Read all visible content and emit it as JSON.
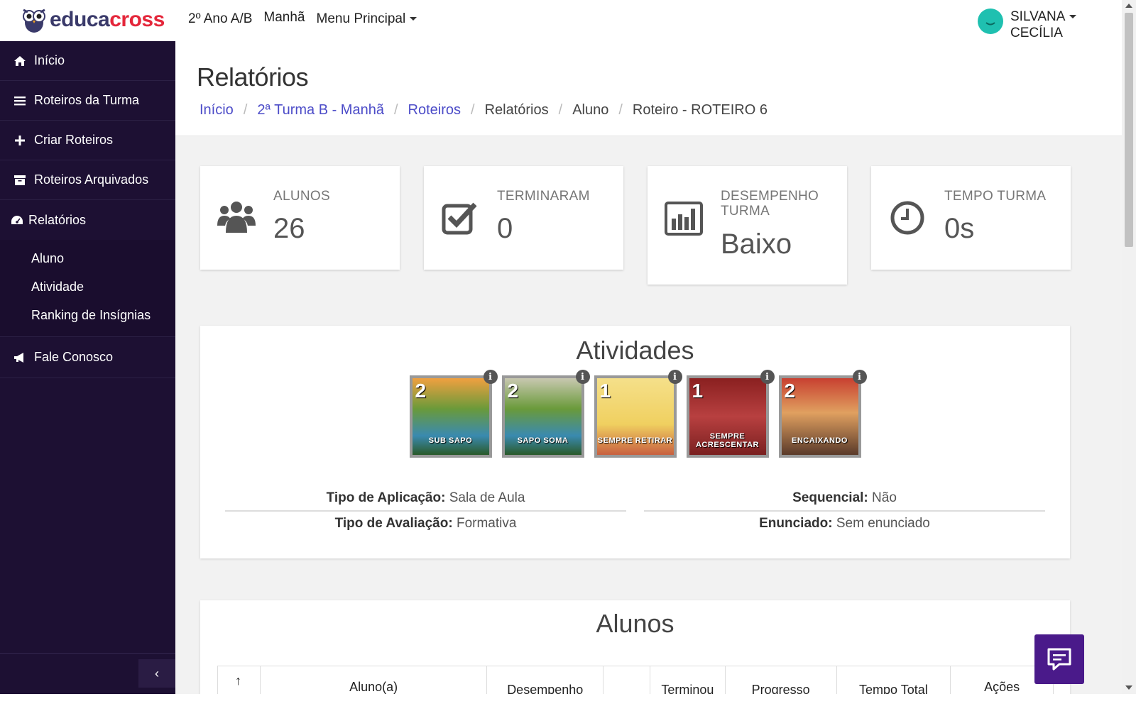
{
  "brand": {
    "logo_part1": "educa",
    "logo_part2": "cross"
  },
  "top_nav": {
    "class_label": "2º Ano A/B",
    "period_label": "Manhã",
    "menu_label": "Menu Principal"
  },
  "user": {
    "first_name": "SILVANA",
    "last_name": "CECÍLIA"
  },
  "sidebar": {
    "items": [
      {
        "label": "Início",
        "icon": "home-icon"
      },
      {
        "label": "Roteiros da Turma",
        "icon": "list-icon"
      },
      {
        "label": "Criar Roteiros",
        "icon": "plus-icon"
      },
      {
        "label": "Roteiros Arquivados",
        "icon": "archive-icon"
      },
      {
        "label": "Relatórios",
        "icon": "dashboard-icon"
      },
      {
        "label": "Fale Conosco",
        "icon": "megaphone-icon"
      }
    ],
    "subitems": [
      {
        "label": "Aluno"
      },
      {
        "label": "Atividade"
      },
      {
        "label": "Ranking de Insígnias"
      }
    ],
    "collapse_glyph": "‹"
  },
  "page": {
    "title": "Relatórios",
    "breadcrumb": [
      {
        "label": "Início",
        "link": true
      },
      {
        "label": "2ª Turma B - Manhã",
        "link": true
      },
      {
        "label": "Roteiros",
        "link": true
      },
      {
        "label": "Relatórios",
        "link": false
      },
      {
        "label": "Aluno",
        "link": false
      },
      {
        "label": "Roteiro - ROTEIRO 6",
        "link": false
      }
    ]
  },
  "stats": [
    {
      "label": "ALUNOS",
      "value": "26",
      "icon": "users-icon"
    },
    {
      "label": "TERMINARAM",
      "value": "0",
      "icon": "checkbox-icon"
    },
    {
      "label": "DESEMPENHO TURMA",
      "value": "Baixo",
      "icon": "bar-chart-icon"
    },
    {
      "label": "TEMPO TURMA",
      "value": "0s",
      "icon": "clock-icon"
    }
  ],
  "activities_card": {
    "title": "Atividades",
    "items": [
      {
        "num": "2",
        "name": "SUB SAPO",
        "bg": "#5a8a3a"
      },
      {
        "num": "2",
        "name": "SAPO SOMA",
        "bg": "#6a8f4a"
      },
      {
        "num": "1",
        "name": "SEMPRE RETIRAR",
        "bg": "#e8c85a"
      },
      {
        "num": "1",
        "name": "SEMPRE ACRESCENTAR",
        "bg": "#9a2a2a"
      },
      {
        "num": "2",
        "name": "ENCAIXANDO",
        "bg": "#b33a2a"
      }
    ],
    "info_glyph": "i",
    "meta": {
      "tipo_aplicacao_label": "Tipo de Aplicação:",
      "tipo_aplicacao_value": "Sala de Aula",
      "tipo_avaliacao_label": "Tipo de Avaliação:",
      "tipo_avaliacao_value": "Formativa",
      "sequencial_label": "Sequencial:",
      "sequencial_value": "Não",
      "enunciado_label": "Enunciado:",
      "enunciado_value": "Sem enunciado"
    }
  },
  "students_card": {
    "title": "Alunos",
    "columns": [
      "↑",
      "Aluno(a)",
      "Desempenho",
      "",
      "Terminou",
      "Progresso",
      "Tempo Total",
      "Ações"
    ]
  },
  "colors": {
    "sidebar_bg": "#1d1033",
    "accent_link": "#4c4cc8",
    "chat_button": "#4a1a8a",
    "avatar": "#1fc0b0",
    "brand_red": "#e4263a"
  }
}
